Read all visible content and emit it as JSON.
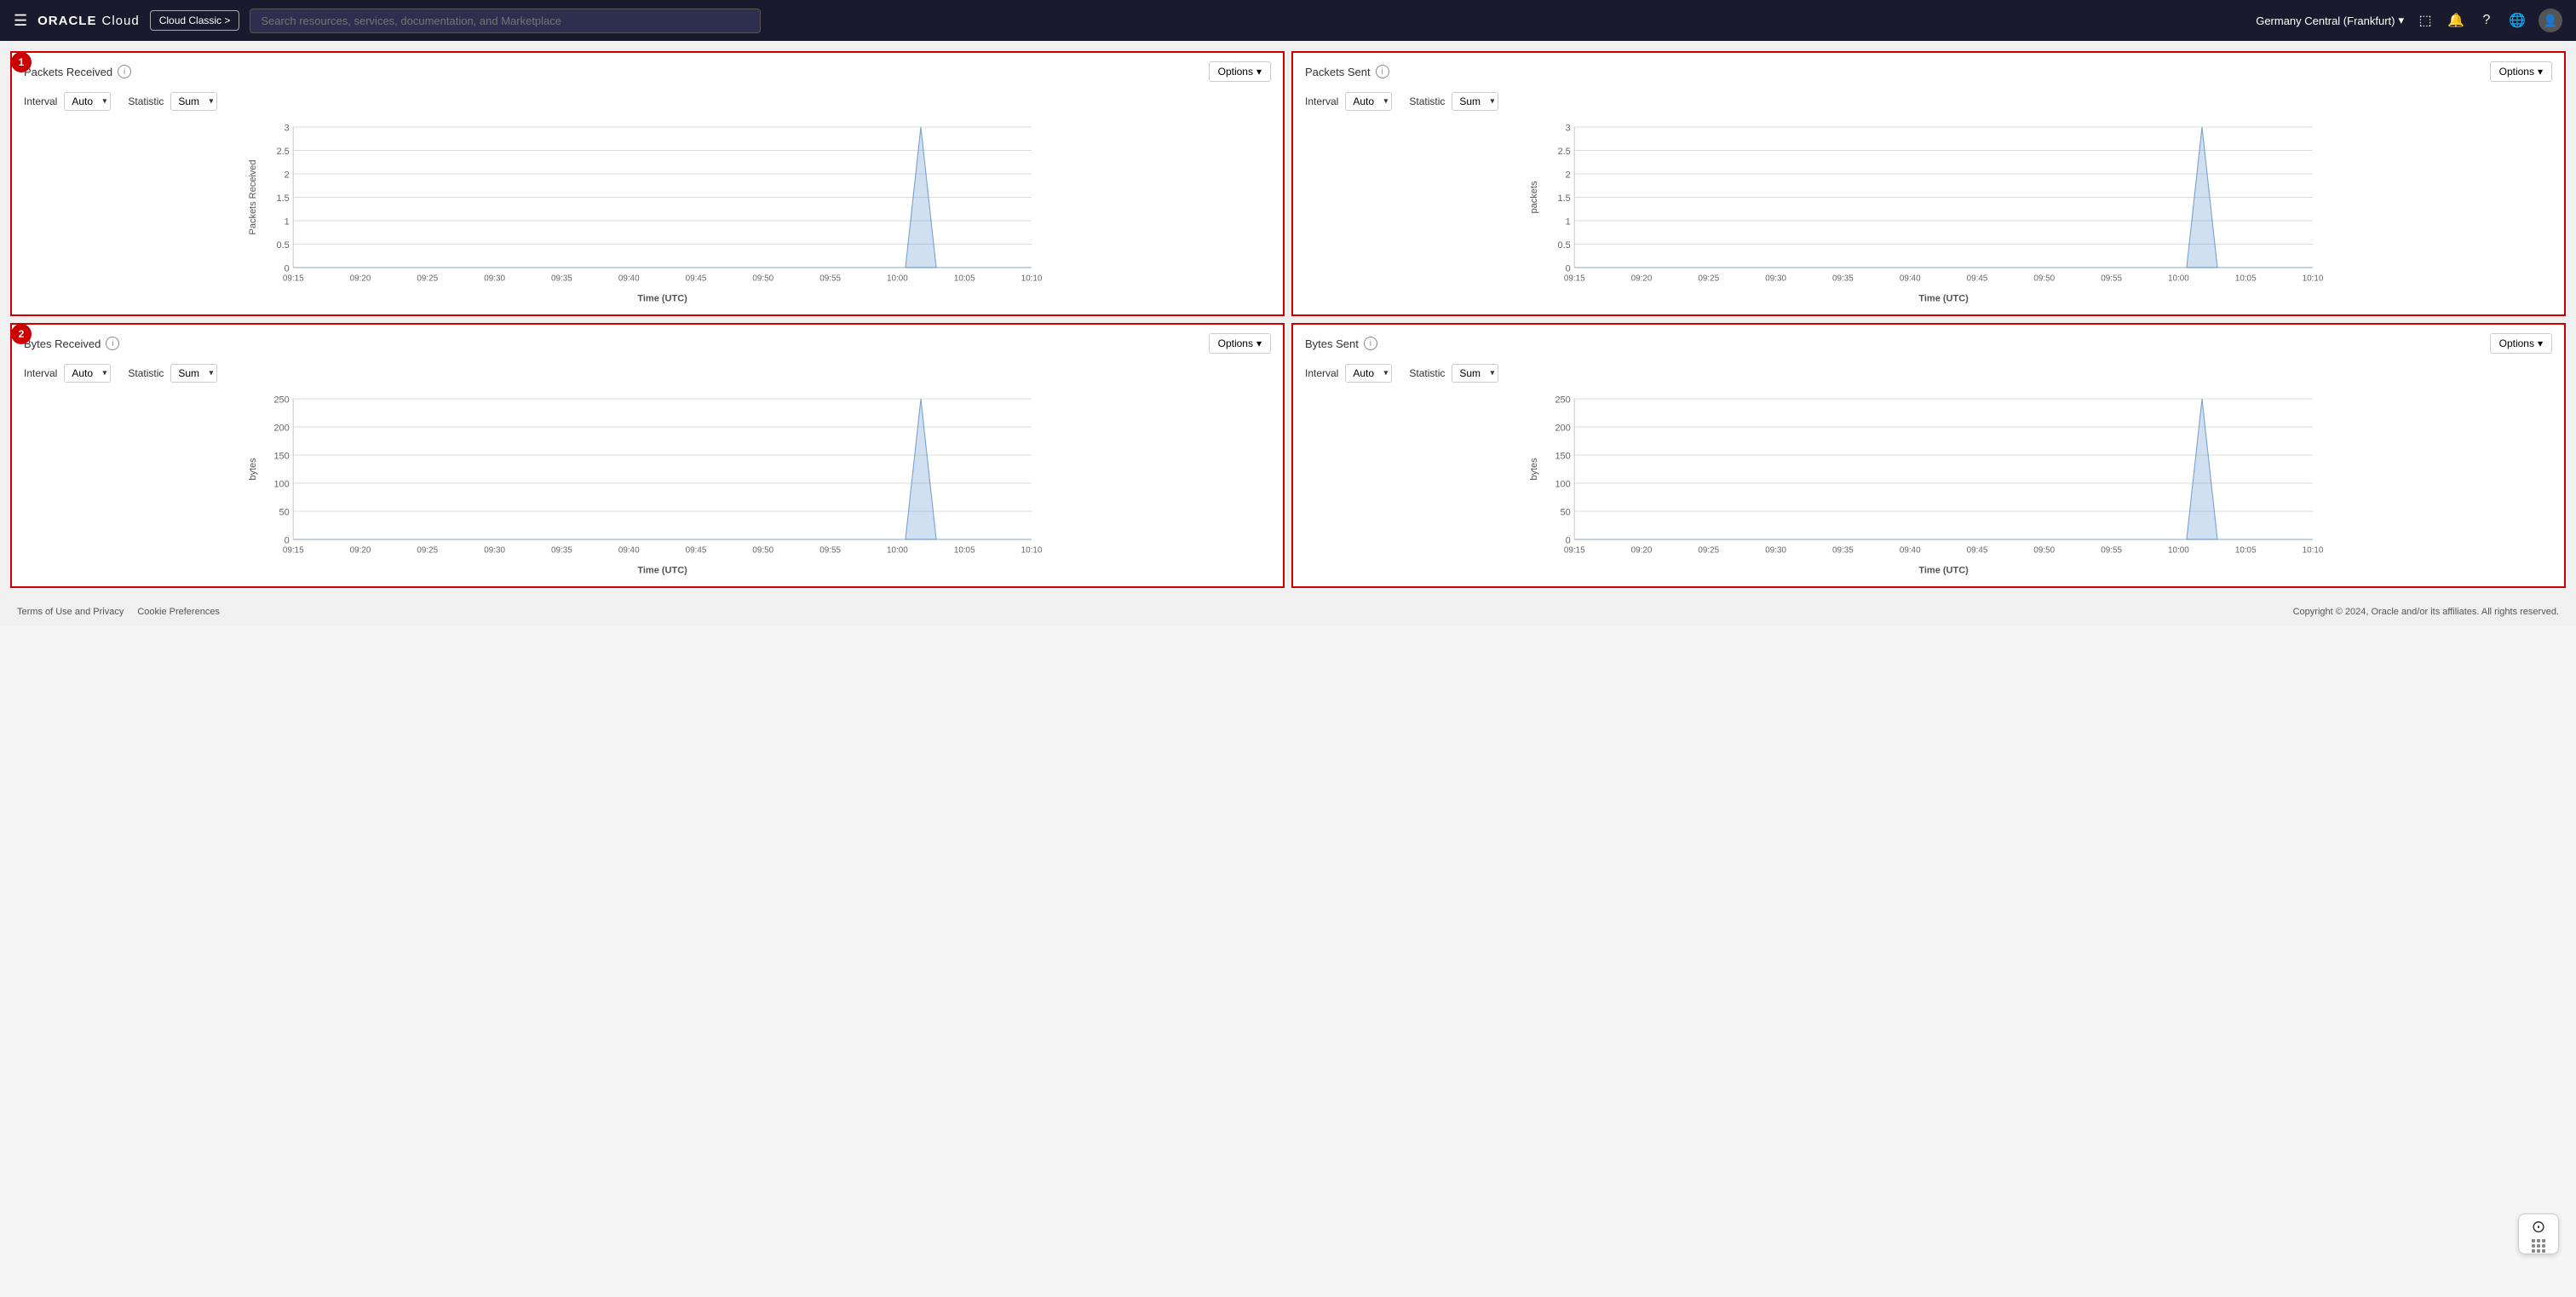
{
  "header": {
    "logo_oracle": "ORACLE",
    "logo_cloud": "Cloud",
    "cloud_classic_label": "Cloud Classic >",
    "search_placeholder": "Search resources, services, documentation, and Marketplace",
    "region_label": "Germany Central (Frankfurt)",
    "region_chevron": "▾",
    "icons": {
      "terminal": "⬜",
      "bell": "🔔",
      "question": "?",
      "globe": "🌐",
      "user": "👤"
    }
  },
  "time_axis": {
    "labels": [
      "09:15",
      "09:20",
      "09:25",
      "09:30",
      "09:35",
      "09:40",
      "09:45",
      "09:50",
      "09:55",
      "10:00",
      "10:05",
      "10:10"
    ],
    "axis_label": "Time (UTC)"
  },
  "charts": [
    {
      "id": "packets-received",
      "badge": "1",
      "title": "Packets Received",
      "options_label": "Options",
      "interval_label": "Interval",
      "interval_value": "Auto",
      "statistic_label": "Statistic",
      "statistic_value": "Sum",
      "y_axis_label": "Packets Received",
      "y_ticks": [
        "0",
        "0.5",
        "1",
        "1.5",
        "2",
        "2.5",
        "3"
      ],
      "spike_position": 0.85,
      "spike_height": 3,
      "y_max": 3,
      "x_labels": [
        "09:15",
        "09:20",
        "09:25",
        "09:30",
        "09:35",
        "09:40",
        "09:45",
        "09:50",
        "09:55",
        "10:00",
        "10:05",
        "10:10"
      ],
      "axis_title": "Time (UTC)"
    },
    {
      "id": "packets-sent",
      "badge": null,
      "title": "Packets Sent",
      "options_label": "Options",
      "interval_label": "Interval",
      "interval_value": "Auto",
      "statistic_label": "Statistic",
      "statistic_value": "Sum",
      "y_axis_label": "packets",
      "y_ticks": [
        "0",
        "0.5",
        "1",
        "1.5",
        "2",
        "2.5",
        "3"
      ],
      "spike_position": 0.85,
      "spike_height": 3,
      "y_max": 3,
      "x_labels": [
        "09:15",
        "09:20",
        "09:25",
        "09:30",
        "09:35",
        "09:40",
        "09:45",
        "09:50",
        "09:55",
        "10:00",
        "10:05",
        "10:10"
      ],
      "axis_title": "Time (UTC)"
    },
    {
      "id": "bytes-received",
      "badge": "2",
      "title": "Bytes Received",
      "options_label": "Options",
      "interval_label": "Interval",
      "interval_value": "Auto",
      "statistic_label": "Statistic",
      "statistic_value": "Sum",
      "y_axis_label": "bytes",
      "y_ticks": [
        "0",
        "50",
        "100",
        "150",
        "200",
        "250"
      ],
      "spike_position": 0.85,
      "spike_height": 250,
      "y_max": 250,
      "x_labels": [
        "09:15",
        "09:20",
        "09:25",
        "09:30",
        "09:35",
        "09:40",
        "09:45",
        "09:50",
        "09:55",
        "10:00",
        "10:05",
        "10:10"
      ],
      "axis_title": "Time (UTC)"
    },
    {
      "id": "bytes-sent",
      "badge": null,
      "title": "Bytes Sent",
      "options_label": "Options",
      "interval_label": "Interval",
      "interval_value": "Auto",
      "statistic_label": "Statistic",
      "statistic_value": "Sum",
      "y_axis_label": "bytes",
      "y_ticks": [
        "0",
        "50",
        "100",
        "150",
        "200",
        "250"
      ],
      "spike_position": 0.85,
      "spike_height": 250,
      "y_max": 250,
      "x_labels": [
        "09:15",
        "09:20",
        "09:25",
        "09:30",
        "09:35",
        "09:40",
        "09:45",
        "09:50",
        "09:55",
        "10:00",
        "10:05",
        "10:10"
      ],
      "axis_title": "Time (UTC)"
    }
  ],
  "footer": {
    "terms_label": "Terms of Use and Privacy",
    "cookie_label": "Cookie Preferences",
    "copyright": "Copyright © 2024, Oracle and/or its affiliates. All rights reserved."
  }
}
